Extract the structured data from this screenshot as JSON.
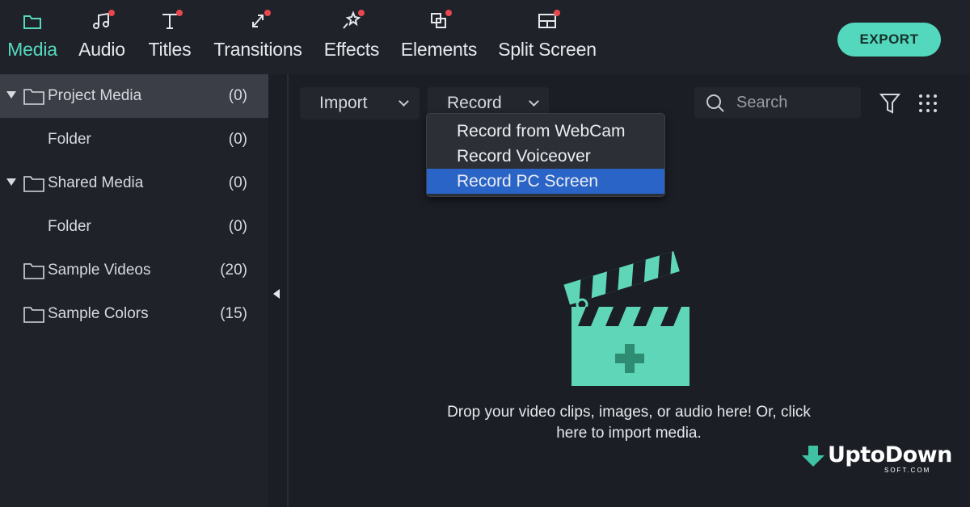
{
  "toolbar": {
    "tabs": [
      {
        "label": "Media",
        "icon": "folder-icon",
        "active": true,
        "badge": false
      },
      {
        "label": "Audio",
        "icon": "music-note-icon",
        "active": false,
        "badge": true
      },
      {
        "label": "Titles",
        "icon": "text-icon",
        "active": false,
        "badge": true
      },
      {
        "label": "Transitions",
        "icon": "transition-icon",
        "active": false,
        "badge": true
      },
      {
        "label": "Effects",
        "icon": "effects-icon",
        "active": false,
        "badge": true
      },
      {
        "label": "Elements",
        "icon": "elements-icon",
        "active": false,
        "badge": true
      },
      {
        "label": "Split Screen",
        "icon": "split-screen-icon",
        "active": false,
        "badge": true
      }
    ],
    "export_label": "EXPORT"
  },
  "sidebar": {
    "items": [
      {
        "label": "Project Media",
        "count": "(0)",
        "expanded": true,
        "selected": true
      },
      {
        "label": "Folder",
        "count": "(0)"
      },
      {
        "label": "Shared Media",
        "count": "(0)",
        "expanded": true
      },
      {
        "label": "Folder",
        "count": "(0)"
      },
      {
        "label": "Sample Videos",
        "count": "(20)"
      },
      {
        "label": "Sample Colors",
        "count": "(15)"
      }
    ]
  },
  "main": {
    "import_label": "Import",
    "record_label": "Record",
    "search_placeholder": "Search",
    "record_menu": {
      "items": [
        "Record from WebCam",
        "Record Voiceover",
        "Record PC Screen"
      ],
      "highlighted": "Record PC Screen"
    },
    "empty_line1": "Drop your video clips, images, or audio here! Or, click",
    "empty_line2": "here to import media."
  },
  "watermark": {
    "text": "UptoDown",
    "sub": "SOFT.COM"
  },
  "colors": {
    "accent": "#55d9bf",
    "badge": "#e8484d",
    "highlight": "#2a64c6",
    "background": "#1b1e25",
    "panel": "#1f2229"
  }
}
